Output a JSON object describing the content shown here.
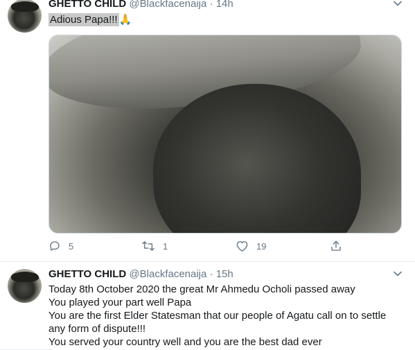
{
  "tweets": [
    {
      "name": "GHETTO CHILD",
      "handle": "@Blackfacenaija",
      "dot": "·",
      "time": "14h",
      "text": "Adious Papa!!!",
      "emoji": "🙏",
      "stats": {
        "replies": "5",
        "retweets": "1",
        "likes": "19"
      }
    },
    {
      "name": "GHETTO CHILD",
      "handle": "@Blackfacenaija",
      "dot": "·",
      "time": "15h",
      "lines": [
        "Today 8th October 2020 the great Mr Ahmedu Ocholi passed away",
        "You played your part well Papa",
        "You are the first Elder Statesman that our people of Agatu call on to settle any form of dispute!!!",
        "You served your country well and you are the best dad ever"
      ]
    }
  ],
  "icons": {
    "reply": "reply-icon",
    "retweet": "retweet-icon",
    "like": "heart-icon",
    "share": "share-icon",
    "caret": "chevron-down-icon"
  },
  "colors": {
    "muted": "#657786",
    "text": "#14171a",
    "border": "#e6ecf0"
  }
}
